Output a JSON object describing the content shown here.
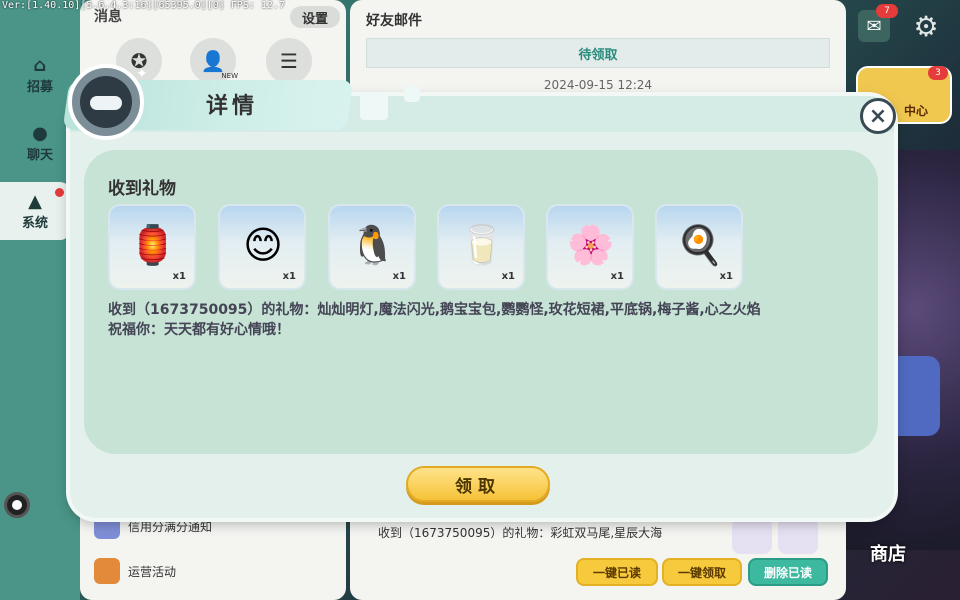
{
  "debug_info": "Ver:[1.40.10][5.6.4.3:16][65395.0][0] FPS: 12.7",
  "left_nav": {
    "items": [
      {
        "label": "招募",
        "icon": "house-icon"
      },
      {
        "label": "聊天",
        "icon": "chat-bubble-icon"
      },
      {
        "label": "系统",
        "icon": "bell-icon"
      }
    ]
  },
  "messages_panel": {
    "title": "消息",
    "settings_label": "设置",
    "tabs": [
      {
        "icon": "star-badge-icon"
      },
      {
        "icon": "new-friend-icon",
        "tag": "NEW"
      },
      {
        "icon": "list-icon"
      }
    ],
    "notices": [
      {
        "text": "信用分满分通知"
      },
      {
        "text": "运营活动"
      }
    ]
  },
  "mail_panel": {
    "title": "好友邮件",
    "pending_label": "待领取",
    "date": "2024-09-15 12:24",
    "snippet_line1": "收到（1673750095）的礼物：彩虹双马尾,星辰大海",
    "buttons": {
      "read_all": "一键已读",
      "claim_all": "一键领取",
      "delete_read": "删除已读"
    }
  },
  "top_right": {
    "mail_badge": "7",
    "activity_badge": "3",
    "activity_label": "中心",
    "shop_label": "商店"
  },
  "dialog": {
    "title": "详情",
    "close_symbol": "×",
    "heading": "收到礼物",
    "gifts": [
      {
        "icon": "lantern-icon",
        "art": "🏮",
        "qty": "x1"
      },
      {
        "icon": "face-makeup-icon",
        "art": "😊",
        "qty": "x1"
      },
      {
        "icon": "penguin-backpack-icon",
        "art": "🐧",
        "qty": "x1"
      },
      {
        "icon": "shoes-icon",
        "art": "🥛",
        "qty": "x1"
      },
      {
        "icon": "skirt-icon",
        "art": "🌸",
        "qty": "x1"
      },
      {
        "icon": "frying-pan-icon",
        "art": "🍳",
        "qty": "x1"
      }
    ],
    "message_line1": "收到（1673750095）的礼物：灿灿明灯,魔法闪光,鹅宝宝包,鹦鹦怪,玫花短裙,平底锅,梅子酱,心之火焰",
    "message_line2": "祝福你：天天都有好心情哦！",
    "claim_label": "领取"
  },
  "colors": {
    "accent_teal": "#2a8c7d",
    "button_yellow": "#f6c338",
    "button_green": "#3db9a0",
    "badge_red": "#e63b3b"
  }
}
